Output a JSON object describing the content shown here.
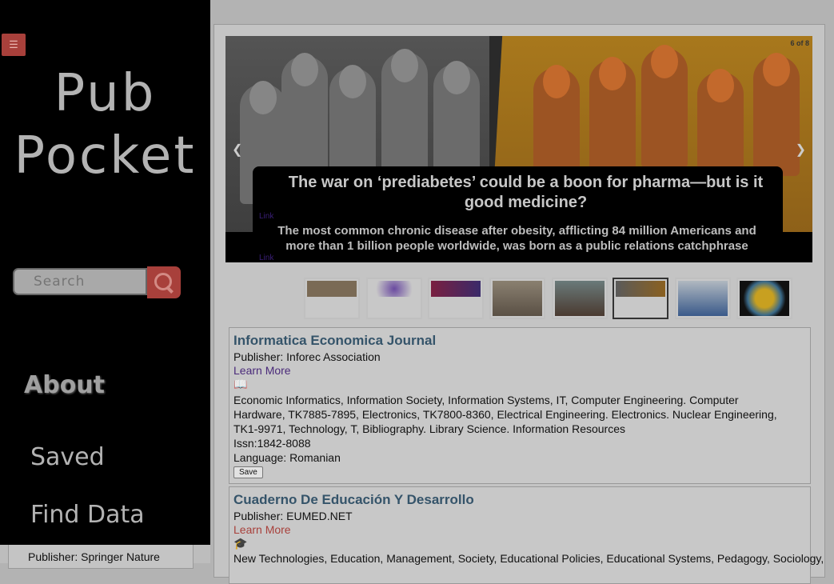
{
  "sidebar": {
    "menu_icon": "hamburger-icon",
    "brand_line1": "Pub",
    "brand_line2": "Pocket",
    "search_placeholder": "Search",
    "search_icon": "search-icon",
    "nav": [
      "About",
      "Saved",
      "Find Data"
    ]
  },
  "slider": {
    "counter": "6 of 8",
    "title": "The war on ‘prediabetes’ could be a boon for pharma—but is it good medicine?",
    "description": "The most common chronic disease after obesity, afflicting 84 million Americans and more than 1 billion people worldwide, was born as a public relations catchphrase",
    "link1": "Link",
    "link2": "Link",
    "prev_icon": "chevron-left-icon",
    "next_icon": "chevron-right-icon",
    "active_index": 6,
    "thumbnails": 8
  },
  "journals": [
    {
      "title": "Informatica Economica Journal",
      "publisher": "Publisher: Inforec Association",
      "learn_more": "Learn More",
      "icon": "book-reader-icon",
      "subjects": "Economic Informatics, Information Society, Information Systems, IT, Computer Engineering. Computer Hardware, TK7885-7895, Electronics, TK7800-8360, Electrical Engineering. Electronics. Nuclear Engineering, TK1-9971, Technology, T, Bibliography. Library Science. Information Resources",
      "issn": "Issn:1842-8088",
      "language": "Language: Romanian",
      "save": "Save"
    },
    {
      "title": "Cuaderno De Educación Y Desarrollo",
      "publisher": "Publisher: EUMED.NET",
      "learn_more": "Learn More",
      "icon": "graduation-cap-icon",
      "subjects": "New Technologies, Education, Management, Society, Educational Policies, Educational Systems, Pedagogy, Sociology,"
    }
  ],
  "background_peek": "Publisher: Springer Nature",
  "colors": {
    "accent": "#a8403b",
    "title_blue": "#35546a",
    "visited": "#4a2a7a"
  }
}
